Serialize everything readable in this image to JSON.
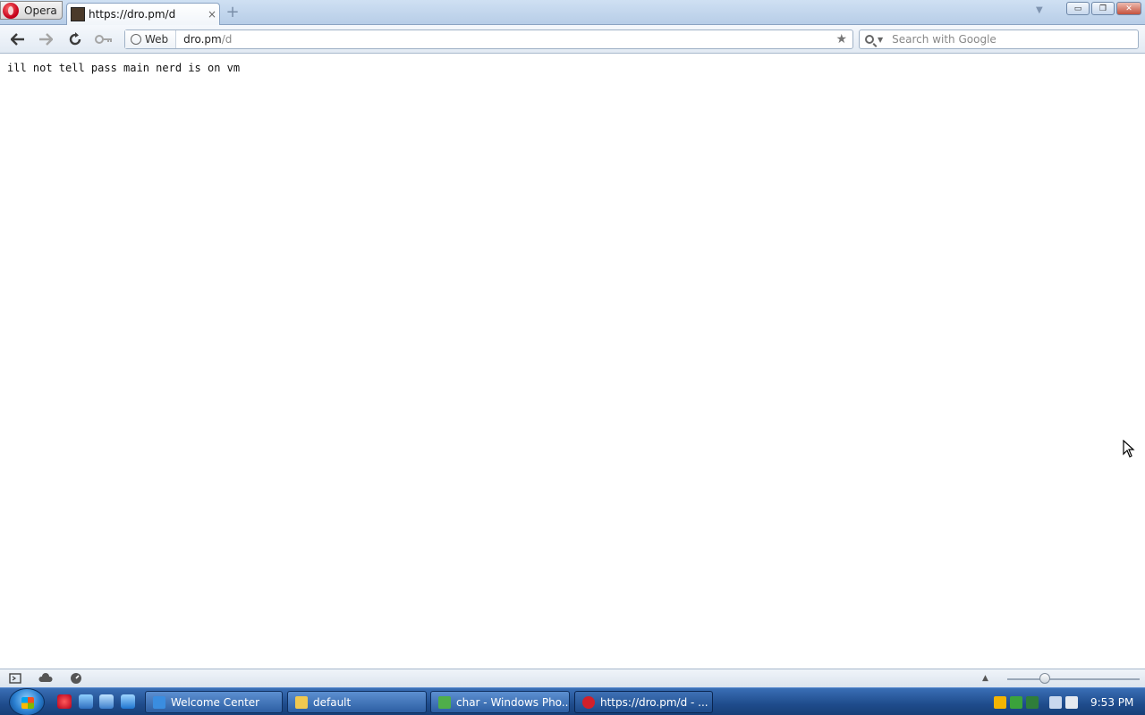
{
  "browser": {
    "menu_label": "Opera",
    "tab": {
      "title": "https://dro.pm/d",
      "close": "×"
    },
    "new_tab": "+",
    "window_buttons": {
      "minimize": "▭",
      "restore": "❐",
      "close": "✕"
    }
  },
  "address_bar": {
    "badge": "Web",
    "host": "dro.pm",
    "path": "/d"
  },
  "search": {
    "placeholder": "Search with Google"
  },
  "page": {
    "text": "ill not tell pass main nerd is on vm"
  },
  "taskbar": {
    "tasks": [
      {
        "label": "Welcome Center",
        "icon_color": "#3a8de0"
      },
      {
        "label": "default",
        "icon_color": "#f0c850"
      },
      {
        "label": "char - Windows Pho...",
        "icon_color": "#4fae4a"
      },
      {
        "label": "https://dro.pm/d - ...",
        "icon_color": "#d2202a"
      }
    ],
    "clock": "9:53 PM"
  }
}
